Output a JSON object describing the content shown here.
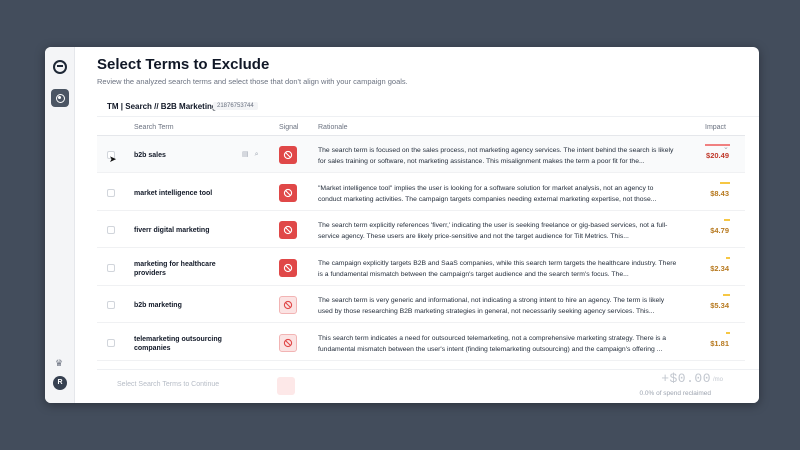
{
  "page": {
    "title": "Select Terms to Exclude",
    "subtitle": "Review the analyzed search terms and select those that don't align with your campaign goals."
  },
  "campaign": {
    "name": "TM | Search // B2B Marketing",
    "id": "21876753744"
  },
  "columns": {
    "term": "Search Term",
    "signal": "Signal",
    "rationale": "Rationale",
    "impact": "Impact"
  },
  "rail": {
    "avatar_initial": "R",
    "crown_icon": "♛"
  },
  "rows": [
    {
      "term": "b2b sales",
      "signal": "strong",
      "rationale": "The search term is focused on the sales process, not marketing agency services. The intent behind the search is likely for sales training or software, not marketing assistance. This misalignment makes the term a poor fit for the...",
      "impact": "$20.49",
      "impact_color": "#c0392b",
      "bar_color": "#f08080",
      "bar_level": 0.9
    },
    {
      "term": "market intelligence tool",
      "signal": "strong",
      "rationale": "\"Market intelligence tool\" implies the user is looking for a software solution for market analysis, not an agency to conduct marketing activities. The campaign targets companies needing external marketing expertise, not those...",
      "impact": "$8.43",
      "impact_color": "#b7791f",
      "bar_color": "#f6c744",
      "bar_level": 0.35
    },
    {
      "term": "fiverr digital marketing",
      "signal": "strong",
      "rationale": "The search term explicitly references 'fiverr,' indicating the user is seeking freelance or gig-based services, not a full-service agency. These users are likely price-sensitive and not the target audience for Tilt Metrics. This...",
      "impact": "$4.79",
      "impact_color": "#b7791f",
      "bar_color": "#f6c744",
      "bar_level": 0.2
    },
    {
      "term": "marketing for healthcare providers",
      "signal": "strong",
      "rationale": "The campaign explicitly targets B2B and SaaS companies, while this search term targets the healthcare industry. There is a fundamental mismatch between the campaign's target audience and the search term's focus. The...",
      "impact": "$2.34",
      "impact_color": "#b7791f",
      "bar_color": "#f6c744",
      "bar_level": 0.1
    },
    {
      "term": "b2b marketing",
      "signal": "weak",
      "rationale": "The search term is very generic and informational, not indicating a strong intent to hire an agency. The term is likely used by those researching B2B marketing strategies in general, not necessarily seeking agency services. This...",
      "impact": "$5.34",
      "impact_color": "#b7791f",
      "bar_color": "#f6c744",
      "bar_level": 0.25
    },
    {
      "term": "telemarketing outsourcing companies",
      "signal": "weak",
      "rationale": "This search term indicates a need for outsourced telemarketing, not a comprehensive marketing strategy. There is a fundamental mismatch between the user's intent (finding telemarketing outsourcing) and the campaign's offering ...",
      "impact": "$1.81",
      "impact_color": "#b7791f",
      "bar_color": "#f6c744",
      "bar_level": 0.08
    }
  ],
  "footer": {
    "continue_label": "Select Search Terms to Continue",
    "total": "+$0.00",
    "per": "/mo",
    "reclaimed": "0.0% of spend reclaimed"
  }
}
